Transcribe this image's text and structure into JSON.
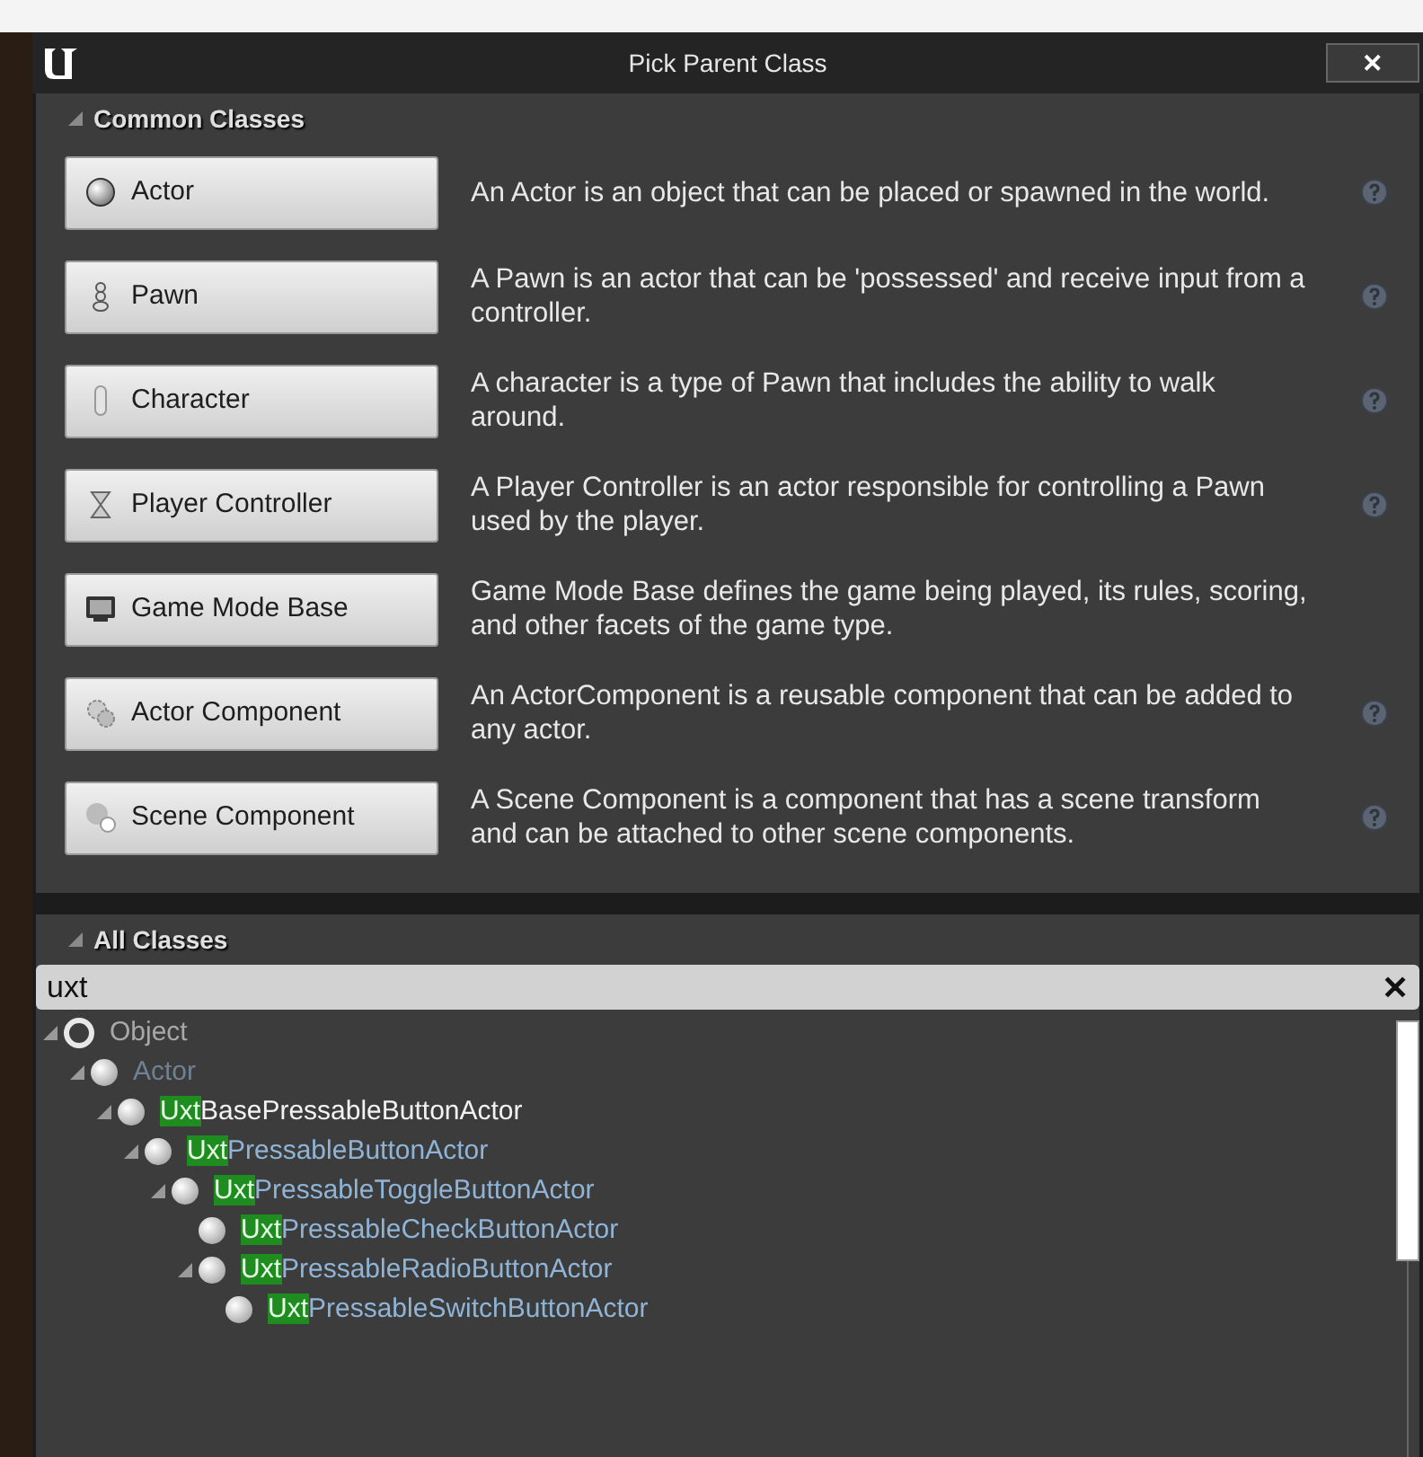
{
  "window": {
    "title": "Pick Parent Class",
    "close_label": "✕"
  },
  "common_classes": {
    "header": "Common Classes",
    "expanded": true,
    "items": [
      {
        "label": "Actor",
        "description": "An Actor is an object that can be placed or spawned in the world.",
        "help": true
      },
      {
        "label": "Pawn",
        "description": "A Pawn is an actor that can be 'possessed' and receive input from a controller.",
        "help": true
      },
      {
        "label": "Character",
        "description": "A character is a type of Pawn that includes the ability to walk around.",
        "help": true
      },
      {
        "label": "Player Controller",
        "description": "A Player Controller is an actor responsible for controlling a Pawn used by the player.",
        "help": true
      },
      {
        "label": "Game Mode Base",
        "description": "Game Mode Base defines the game being played, its rules, scoring, and other facets of the game type.",
        "help": false
      },
      {
        "label": "Actor Component",
        "description": "An ActorComponent is a reusable component that can be added to any actor.",
        "help": true
      },
      {
        "label": "Scene Component",
        "description": "A Scene Component is a component that has a scene transform and can be attached to other scene components.",
        "help": true
      }
    ]
  },
  "all_classes": {
    "header": "All Classes",
    "expanded": true,
    "search": {
      "value": "uxt",
      "clear_label": "✕"
    },
    "tree": [
      {
        "kind": "root",
        "text": "Object",
        "expanded": true,
        "children": [
          {
            "kind": "ancestor",
            "text": "Actor",
            "expanded": true,
            "children": [
              {
                "kind": "native",
                "highlight": "Uxt",
                "text": "BasePressableButtonActor",
                "expanded": true,
                "children": [
                  {
                    "kind": "blueprint",
                    "highlight": "Uxt",
                    "text": "PressableButtonActor",
                    "expanded": true,
                    "children": [
                      {
                        "kind": "blueprint",
                        "highlight": "Uxt",
                        "text": "PressableToggleButtonActor",
                        "expanded": true,
                        "children": [
                          {
                            "kind": "blueprint",
                            "highlight": "Uxt",
                            "text": "PressableCheckButtonActor",
                            "expanded": false
                          },
                          {
                            "kind": "blueprint",
                            "highlight": "Uxt",
                            "text": "PressableRadioButtonActor",
                            "expanded": true,
                            "children": [
                              {
                                "kind": "blueprint",
                                "highlight": "Uxt",
                                "text": "PressableSwitchButtonActor",
                                "expanded": false
                              }
                            ]
                          }
                        ]
                      }
                    ]
                  }
                ]
              }
            ]
          }
        ]
      }
    ]
  }
}
